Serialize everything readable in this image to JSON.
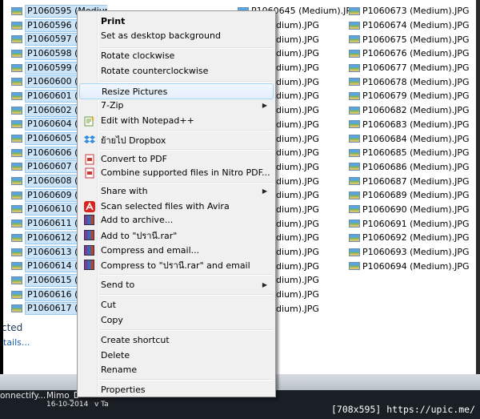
{
  "explorer": {
    "column1": [
      "P1060595 (Medium).JPG",
      "P1060596 (Medium).JPG",
      "P1060597 (Medium).JPG",
      "P1060598 (Medium).JPG",
      "P1060599 (Medium).JPG",
      "P1060600 (Medium).JPG",
      "P1060601 (Medium).JPG",
      "P1060602 (Medium).JPG",
      "P1060604 (Medium).JPG",
      "P1060605 (Medium).JPG",
      "P1060606 (Medium).JPG",
      "P1060607 (Medium).JPG",
      "P1060608 (Medium).JPG",
      "P1060609 (Medium).JPG",
      "P1060610 (Medium).JPG",
      "P1060611 (Medium).JPG",
      "P1060612 (Medium).JPG",
      "P1060613 (Medium).JPG",
      "P1060614 (Medium).JPG",
      "P1060615 (Medium).JPG",
      "P1060616 (Medium).JPG",
      "P1060617 (Medium).JPG"
    ],
    "column2": [
      "P1060645 (Medium).JPG",
      "7 (Medium).JPG",
      "7 (Medium).JPG",
      "3 (Medium).JPG",
      "3 (Medium).JPG",
      "3 (Medium).JPG",
      "4 (Medium).JPG",
      "5 (Medium).JPG",
      "3 (Medium).JPG",
      "3 (Medium).JPG",
      "3 (Medium).JPG",
      "5 (Medium).JPG",
      "1 (Medium).JPG",
      "2 (Medium).JPG",
      "3 (Medium).JPG",
      "4 (Medium).JPG",
      "5 (Medium).JPG",
      "3 (Medium).JPG",
      "3 (Medium).JPG",
      "3 (Medium).JPG",
      "1 (Medium).JPG",
      "2 (Medium).JPG"
    ],
    "column3": [
      "P1060673 (Medium).JPG",
      "P1060674 (Medium).JPG",
      "P1060675 (Medium).JPG",
      "P1060676 (Medium).JPG",
      "P1060677 (Medium).JPG",
      "P1060678 (Medium).JPG",
      "P1060679 (Medium).JPG",
      "P1060682 (Medium).JPG",
      "P1060683 (Medium).JPG",
      "P1060684 (Medium).JPG",
      "P1060685 (Medium).JPG",
      "P1060686 (Medium).JPG",
      "P1060687 (Medium).JPG",
      "P1060689 (Medium).JPG",
      "P1060690 (Medium).JPG",
      "P1060691 (Medium).JPG",
      "P1060692 (Medium).JPG",
      "P1060693 (Medium).JPG",
      "P1060694 (Medium).JPG"
    ],
    "details_label": "cted",
    "details_link": "tails..."
  },
  "context_menu": {
    "print": "Print",
    "set_desktop_background": "Set as desktop background",
    "rotate_clockwise": "Rotate clockwise",
    "rotate_counterclockwise": "Rotate counterclockwise",
    "resize_pictures": "Resize Pictures",
    "seven_zip": "7-Zip",
    "edit_notepad": "Edit with Notepad++",
    "move_dropbox": "ย้ายไป Dropbox",
    "convert_pdf": "Convert to PDF",
    "combine_nitro": "Combine supported files in Nitro PDF...",
    "share_with": "Share with",
    "scan_avira": "Scan selected files with Avira",
    "add_archive": "Add to archive...",
    "add_rar": "Add to \"ปรานี.rar\"",
    "compress_email": "Compress and email...",
    "compress_rar_email": "Compress to \"ปรานี.rar\" and email",
    "send_to": "Send to",
    "cut": "Cut",
    "copy": "Copy",
    "create_shortcut": "Create shortcut",
    "delete": "Delete",
    "rename": "Rename",
    "properties": "Properties"
  },
  "taskbar": {
    "item1": "onnectify...",
    "item2": "Mimo_D",
    "item2_sub": "16-10-2014",
    "item3": "v Ta"
  },
  "watermark": "[708x595] https://upic.me/",
  "colors": {
    "selection": "#cce4f7",
    "menu_bg": "#f0f0f0",
    "highlight_border": "#a8d8f8"
  }
}
